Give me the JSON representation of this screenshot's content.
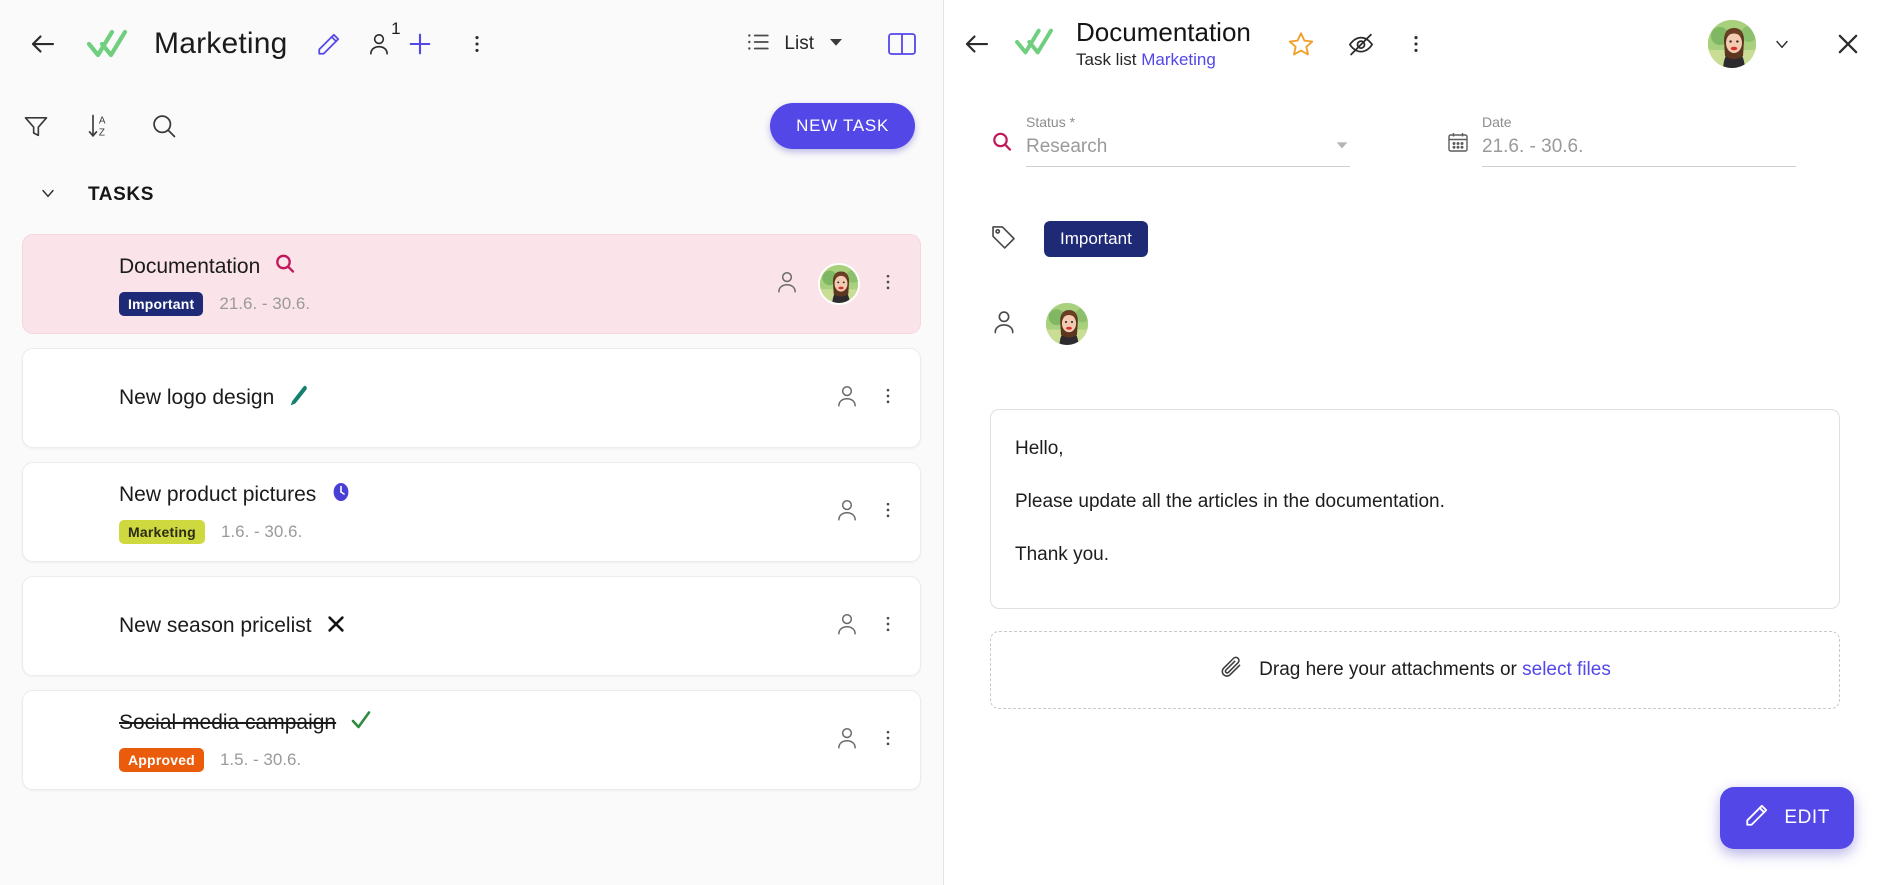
{
  "colors": {
    "accent": "#5347e8",
    "badge_important": "#1f2a77",
    "badge_marketing": "#cdd93e",
    "badge_approved": "#ea5b0c",
    "selected_row": "#fbe3ea",
    "star": "#f0a02a",
    "logo_check": "#6fcf7e",
    "status_search": "#c2185b"
  },
  "left": {
    "header": {
      "title": "Marketing",
      "members_count": "1",
      "view_label": "List"
    },
    "toolbar": {
      "new_task_label": "NEW TASK"
    },
    "section": {
      "title": "TASKS"
    },
    "tasks": [
      {
        "title": "Documentation",
        "status_icon": "search-icon",
        "badge": "Important",
        "badge_class": "important",
        "date": "21.6. - 30.6.",
        "selected": true,
        "has_avatar": true,
        "done": false
      },
      {
        "title": "New logo design",
        "status_icon": "pen-icon",
        "badge": "",
        "badge_class": "",
        "date": "",
        "selected": false,
        "has_avatar": false,
        "done": false
      },
      {
        "title": "New product pictures",
        "status_icon": "clock-icon",
        "badge": "Marketing",
        "badge_class": "marketing",
        "date": "1.6. - 30.6.",
        "selected": false,
        "has_avatar": false,
        "done": false
      },
      {
        "title": "New season pricelist",
        "status_icon": "x-icon",
        "badge": "",
        "badge_class": "",
        "date": "",
        "selected": false,
        "has_avatar": false,
        "done": false
      },
      {
        "title": "Social media campaign",
        "status_icon": "check-icon",
        "badge": "Approved",
        "badge_class": "approved",
        "date": "1.5. - 30.6.",
        "selected": false,
        "has_avatar": false,
        "done": true
      }
    ]
  },
  "right": {
    "header": {
      "title": "Documentation",
      "subtitle_prefix": "Task list",
      "subtitle_link": "Marketing"
    },
    "status_field": {
      "label": "Status *",
      "value": "Research"
    },
    "date_field": {
      "label": "Date",
      "value": "21.6. - 30.6."
    },
    "tag": {
      "label": "Important"
    },
    "description": [
      "Hello,",
      "Please update all the articles in the documentation.",
      "Thank you."
    ],
    "attachments": {
      "text": "Drag here your attachments or",
      "link": "select files"
    },
    "edit_button": {
      "label": "EDIT"
    }
  }
}
